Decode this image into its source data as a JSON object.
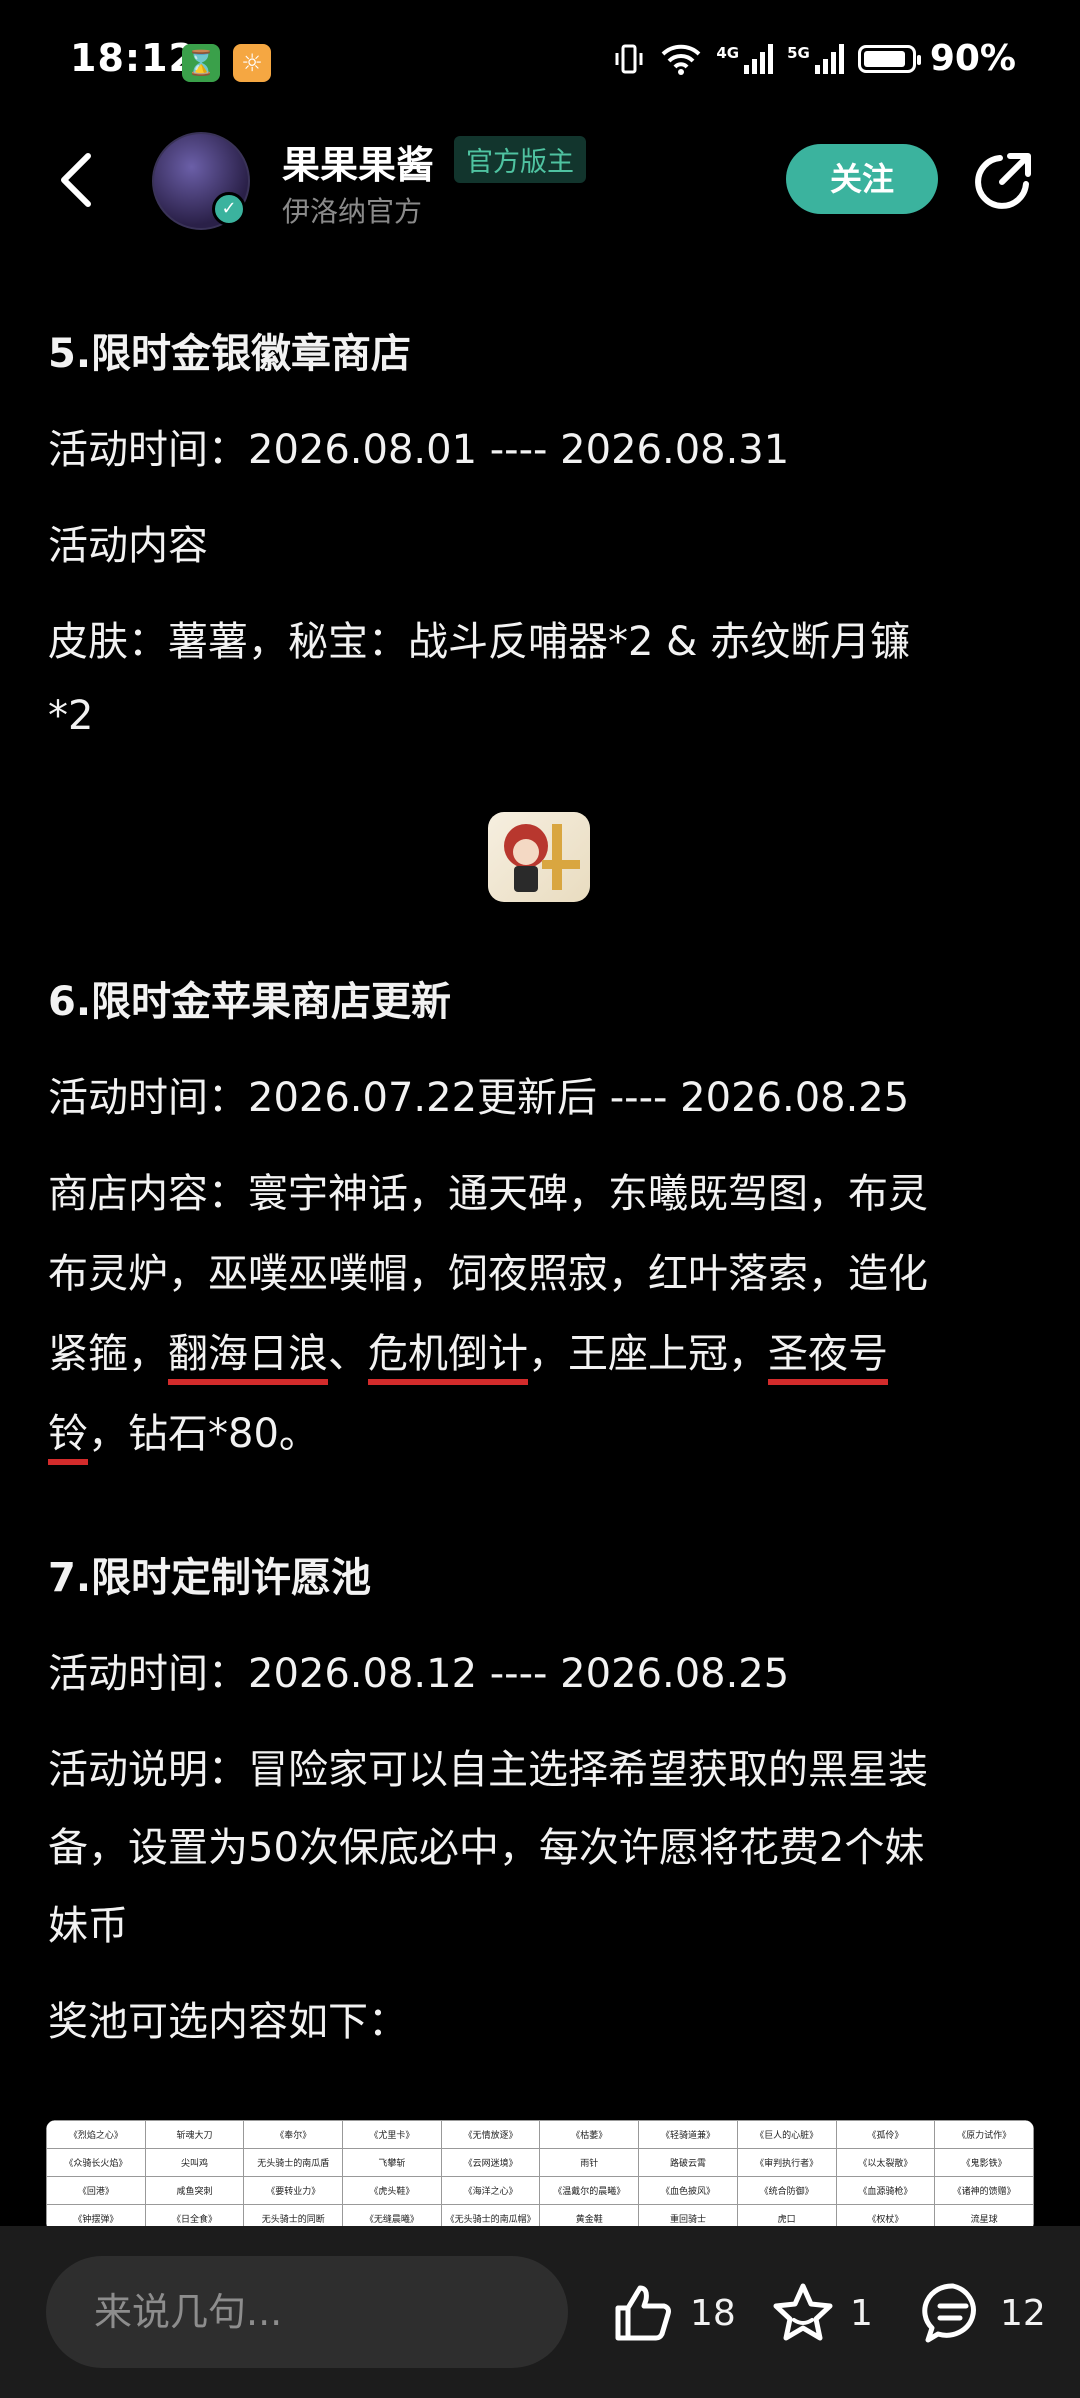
{
  "status_bar": {
    "time": "18:12",
    "signal1_label": "4G",
    "signal2_label": "5G",
    "battery": "90%",
    "battery_level": 0.9
  },
  "header": {
    "author_name": "果果果酱",
    "author_badge": "官方版主",
    "author_subtitle": "伊洛纳官方",
    "follow_label": "关注"
  },
  "article": {
    "s5": {
      "title": "5.限时金银徽章商店",
      "time": "活动时间：2026.08.01 ---- 2026.08.31",
      "content_label": "活动内容",
      "content_line1": "皮肤：薯薯，秘宝：战斗反哺器*2 & 赤纹断月镰",
      "content_line2": "*2"
    },
    "s6": {
      "title": "6.限时金苹果商店更新",
      "time": "活动时间：2026.07.22更新后 ---- 2026.08.25",
      "line1": "商店内容：寰宇神话，通天碑，东曦既驾图，布灵",
      "line2": "布灵炉，巫噗巫噗帽，饲夜照寂，红叶落索，造化",
      "l3_a": "紧箍，",
      "l3_b": "翻海日浪",
      "l3_c": "、",
      "l3_d": "危机倒计",
      "l3_e": "，王座上冠，",
      "l3_f": "圣夜号",
      "l4_a": "铃",
      "l4_b": "，钻石*80。"
    },
    "s7": {
      "title": "7.限时定制许愿池",
      "time": "活动时间：2026.08.12 ---- 2026.08.25",
      "desc1": "活动说明：冒险家可以自主选择希望获取的黑星装",
      "desc2": "备，设置为50次保底必中，每次许愿将花费2个妹",
      "desc3": "妹币",
      "pool_label": "奖池可选内容如下："
    }
  },
  "reward_table": {
    "rows": [
      [
        "《烈焰之心》",
        "斩魂大刀",
        "《奉尔》",
        "《尤里卡》",
        "《无情放逐》",
        "《枯萎》",
        "《轻骑道兼》",
        "《巨人的心脏》",
        "《孤伶》",
        "《原力试作》"
      ],
      [
        "《众骑长火焰》",
        "尖叫鸡",
        "无头骑士的南瓜盾",
        "飞攀斩",
        "《云网迷境》",
        "雨针",
        "路破云霄",
        "《审判执行者》",
        "《以太裂散》",
        "《鬼影铁》"
      ],
      [
        "《回港》",
        "咸鱼突刺",
        "《要转业力》",
        "《虎头鞋》",
        "《海洋之心》",
        "《温戴尔的晨曦》",
        "《血色披风》",
        "《统合防御》",
        "《血源骑枪》",
        "《诸神的馈赠》"
      ],
      [
        "《钟摆弹》",
        "《日全食》",
        "无头骑士的同断",
        "《无缝晨曦》",
        "《无头骑士的南瓜帽》",
        "黄金鞋",
        "重回骑士",
        "虎口",
        "《权杖》",
        "流星球"
      ]
    ]
  },
  "bottom_bar": {
    "comment_placeholder": "来说几句...",
    "like_count": "18",
    "favorite_count": "1",
    "comment_count": "12"
  },
  "colors": {
    "accent": "#3bb39e",
    "underline": "#d32b2b",
    "background": "#000000"
  }
}
